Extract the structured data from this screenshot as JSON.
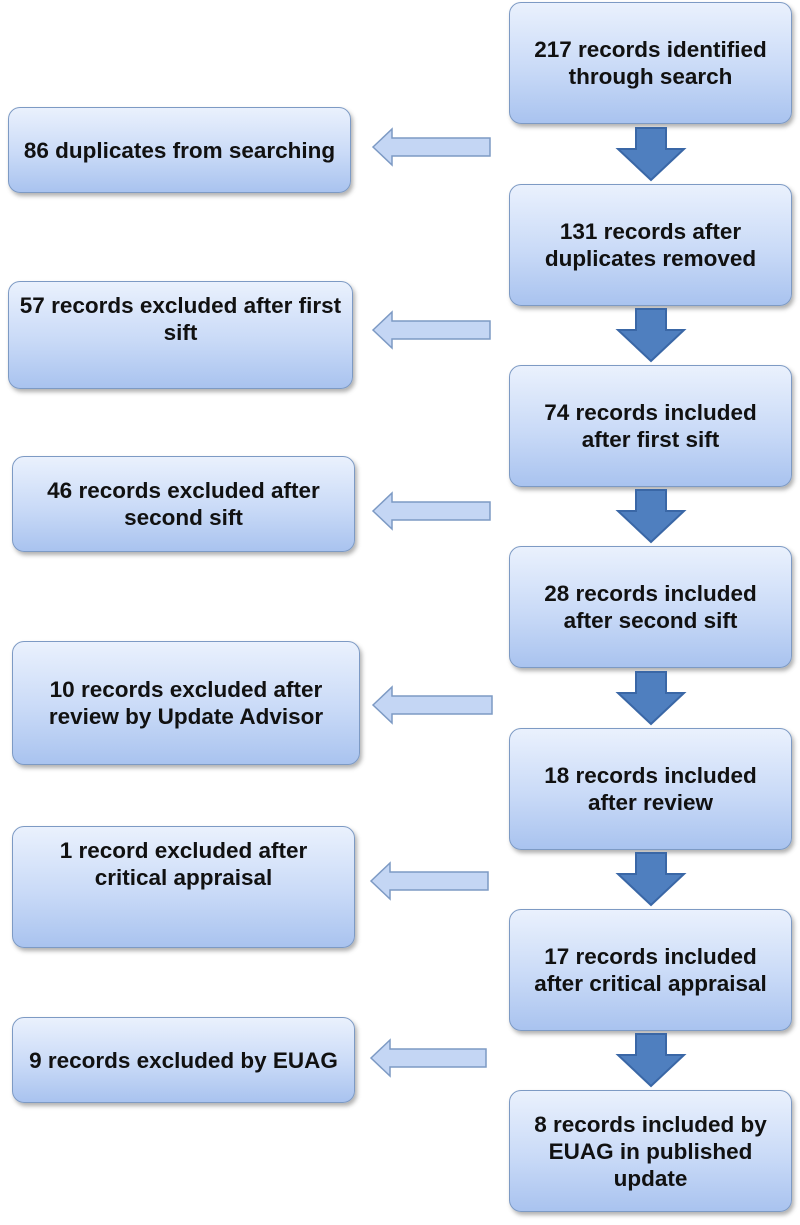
{
  "diagram": {
    "type": "flowchart",
    "colors": {
      "box_fill_top": "#eaf1fd",
      "box_fill_bottom": "#a9c3ef",
      "box_border": "#7d9ac4",
      "down_arrow_fill": "#4f7fbf",
      "down_arrow_stroke": "#3a67a6",
      "side_arrow_fill": "#c4d6f4",
      "side_arrow_stroke": "#7d9ac4",
      "text": "#111111"
    },
    "main_steps": [
      {
        "id": "identified",
        "text": "217 records identified through search"
      },
      {
        "id": "deduplicated",
        "text": "131 records after duplicates removed"
      },
      {
        "id": "first-sift-included",
        "text": "74 records included after first sift"
      },
      {
        "id": "second-sift-included",
        "text": "28 records included after second sift"
      },
      {
        "id": "review-included",
        "text": "18 records included after review"
      },
      {
        "id": "appraisal-included",
        "text": "17 records included after critical appraisal"
      },
      {
        "id": "euag-included",
        "text": "8 records  included by EUAG in published update"
      }
    ],
    "exclusions": [
      {
        "id": "duplicates",
        "text": "86 duplicates from searching"
      },
      {
        "id": "first-sift-excluded",
        "text": "57 records excluded after first sift"
      },
      {
        "id": "second-sift-excluded",
        "text": "46 records excluded after second sift"
      },
      {
        "id": "review-excluded",
        "text": "10 records excluded after review by Update Advisor"
      },
      {
        "id": "appraisal-excluded",
        "text": "1 record excluded after critical appraisal"
      },
      {
        "id": "euag-excluded",
        "text": "9 records excluded by EUAG"
      }
    ]
  }
}
